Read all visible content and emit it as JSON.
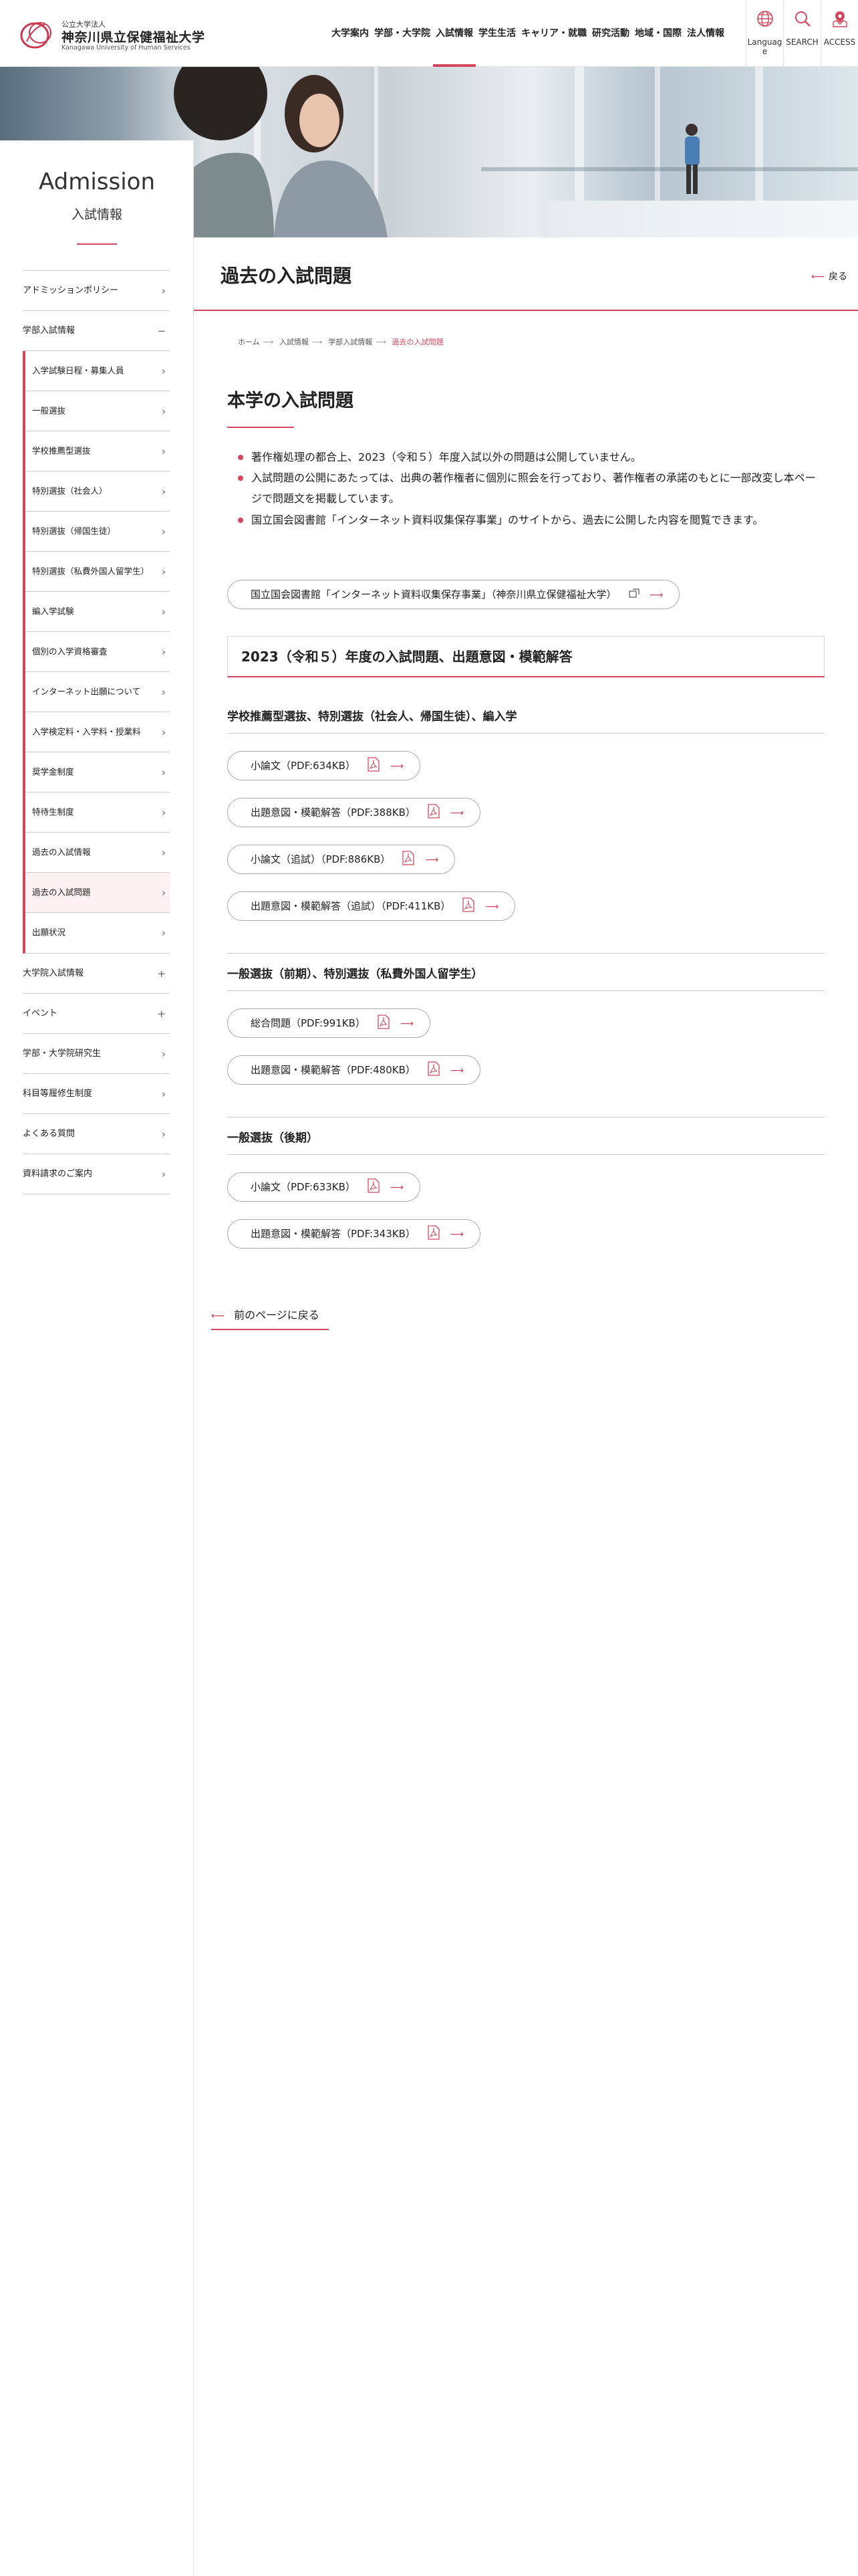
{
  "header": {
    "logo_sub": "公立大学法人",
    "logo_main": "神奈川県立保健福祉大学",
    "logo_en": "Kanagawa University of Human Services",
    "nav": [
      {
        "label": "大学案内",
        "active": false
      },
      {
        "label": "学部・大学院",
        "active": false
      },
      {
        "label": "入試情報",
        "active": true
      },
      {
        "label": "学生生活",
        "active": false
      },
      {
        "label": "キャリア・就職",
        "active": false
      },
      {
        "label": "研究活動",
        "active": false
      },
      {
        "label": "地域・国際",
        "active": false
      },
      {
        "label": "法人情報",
        "active": false
      }
    ],
    "tools": {
      "language": "Language",
      "search": "SEARCH",
      "access": "ACCESS"
    }
  },
  "side": {
    "title": "Admission",
    "subtitle": "入試情報",
    "items_top": [
      {
        "label": "アドミッションポリシー",
        "mark": "›"
      },
      {
        "label": "学部入試情報",
        "mark": "−"
      }
    ],
    "sub_items": [
      {
        "label": "入学試験日程・募集人員",
        "current": false
      },
      {
        "label": "一般選抜",
        "current": false
      },
      {
        "label": "学校推薦型選抜",
        "current": false
      },
      {
        "label": "特別選抜（社会人）",
        "current": false
      },
      {
        "label": "特別選抜（帰国生徒）",
        "current": false
      },
      {
        "label": "特別選抜（私費外国人留学生）",
        "current": false
      },
      {
        "label": "編入学試験",
        "current": false
      },
      {
        "label": "個別の入学資格審査",
        "current": false
      },
      {
        "label": "インターネット出願について",
        "current": false
      },
      {
        "label": "入学検定料・入学料・授業料",
        "current": false
      },
      {
        "label": "奨学金制度",
        "current": false
      },
      {
        "label": "特待生制度",
        "current": false
      },
      {
        "label": "過去の入試情報",
        "current": false
      },
      {
        "label": "過去の入試問題",
        "current": true
      },
      {
        "label": "出願状況",
        "current": false
      }
    ],
    "items_bottom": [
      {
        "label": "大学院入試情報",
        "mark": "+"
      },
      {
        "label": "イベント",
        "mark": "+"
      },
      {
        "label": "学部・大学院研究生",
        "mark": "›"
      },
      {
        "label": "科目等履修生制度",
        "mark": "›"
      },
      {
        "label": "よくある質問",
        "mark": "›"
      },
      {
        "label": "資料請求のご案内",
        "mark": "›"
      }
    ]
  },
  "page": {
    "title": "過去の入試問題",
    "back_label": "戻る",
    "breadcrumb": [
      "ホーム",
      "入試情報",
      "学部入試情報",
      "過去の入試問題"
    ],
    "heading": "本学の入試問題",
    "notes": [
      "著作権処理の都合上、2023（令和５）年度入試以外の問題は公開していません。",
      "入試問題の公開にあたっては、出典の著作権者に個別に照会を行っており、著作権者の承諾のもとに一部改変し本ページで問題文を掲載しています。",
      "国立国会図書館「インターネット資料収集保存事業」のサイトから、過去に公開した内容を閲覧できます。"
    ],
    "warp_link": "国立国会図書館「インターネット資料収集保存事業」（神奈川県立保健福祉大学）",
    "section_title": "2023（令和５）年度の入試問題、出題意図・模範解答",
    "groups": [
      {
        "heading": "学校推薦型選抜、特別選抜（社会人、帰国生徒）、編入学",
        "files": [
          "小論文（PDF:634KB）",
          "出題意図・模範解答（PDF:388KB）",
          "小論文（追試）（PDF:886KB）",
          "出題意図・模範解答（追試）（PDF:411KB）"
        ]
      },
      {
        "heading": "一般選抜（前期）、特別選抜（私費外国人留学生）",
        "files": [
          "総合問題（PDF:991KB）",
          "出題意図・模範解答（PDF:480KB）"
        ]
      },
      {
        "heading": "一般選抜（後期）",
        "files": [
          "小論文（PDF:633KB）",
          "出題意図・模範解答（PDF:343KB）"
        ]
      }
    ],
    "back_prev": "前のページに戻る"
  },
  "colors": {
    "accent": "#d2475e",
    "border": "#cccccc",
    "text": "#222222"
  }
}
